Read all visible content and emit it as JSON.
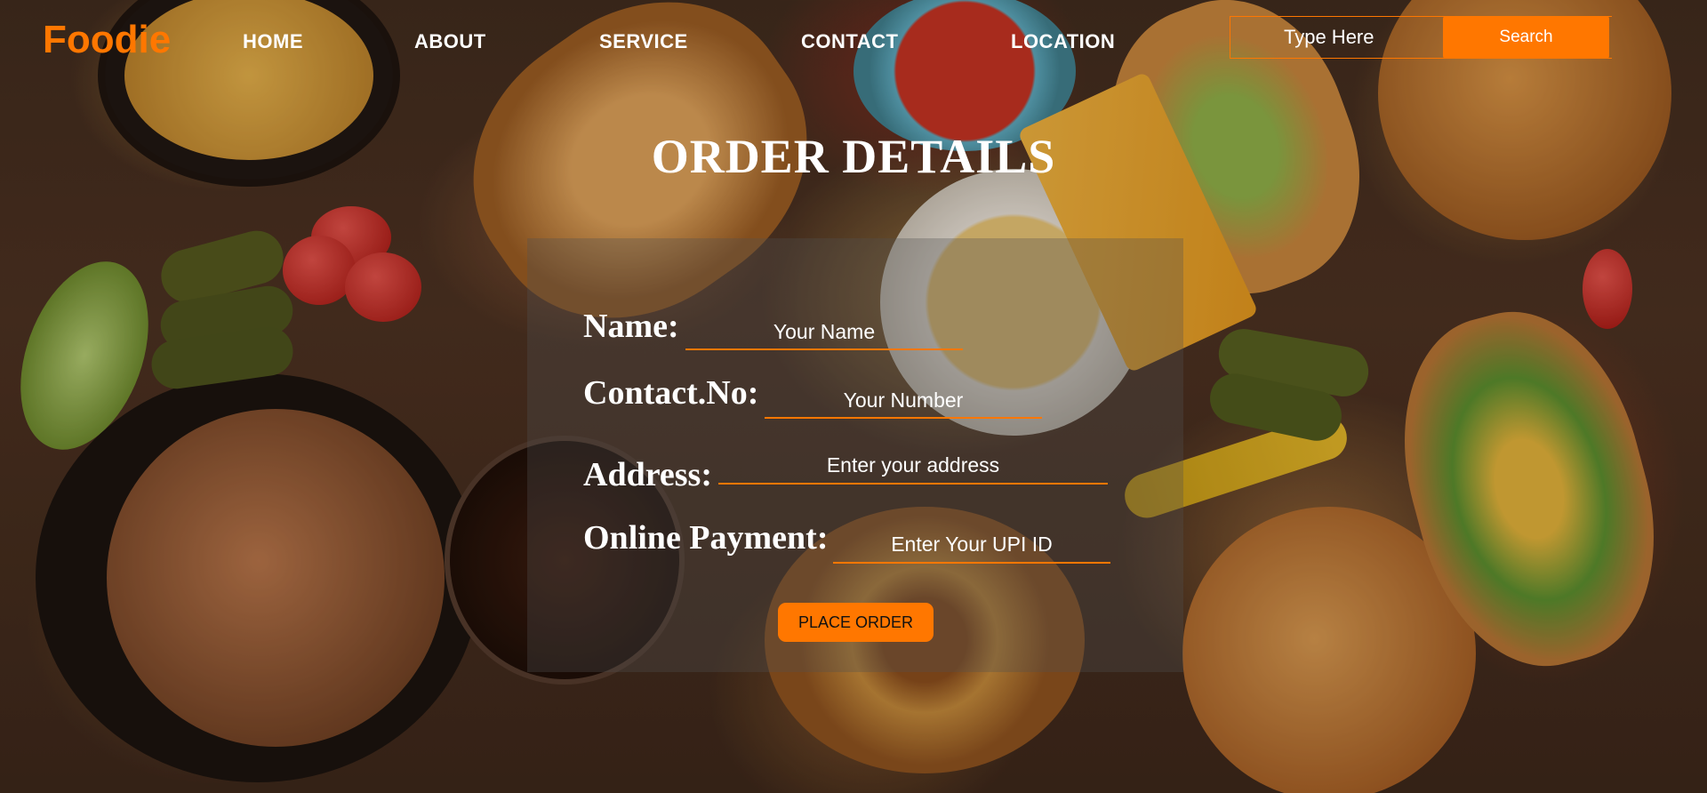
{
  "brand": {
    "logo": "Foodie",
    "accent_color": "#ff7700"
  },
  "nav": {
    "links": [
      "HOME",
      "ABOUT",
      "SERVICE",
      "CONTACT",
      "LOCATION"
    ]
  },
  "search": {
    "placeholder": "Type Here",
    "button_label": "Search"
  },
  "order": {
    "title": "ORDER DETAILS",
    "fields": [
      {
        "label": "Name:",
        "placeholder": "Your Name"
      },
      {
        "label": "Contact.No:",
        "placeholder": "Your Number"
      },
      {
        "label": "Address:",
        "placeholder": "Enter your address"
      },
      {
        "label": "Online Payment:",
        "placeholder": "Enter Your UPI ID"
      }
    ],
    "submit_label": "PLACE ORDER"
  }
}
